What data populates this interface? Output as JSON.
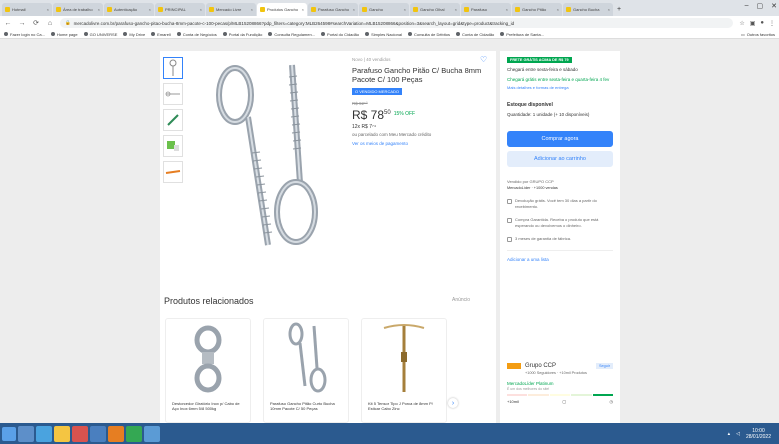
{
  "browser": {
    "tabs": [
      {
        "title": "Hotmail"
      },
      {
        "title": "Área de trabalho"
      },
      {
        "title": "Autenticação"
      },
      {
        "title": "PRINCIPAL"
      },
      {
        "title": "Mercado Livre"
      },
      {
        "title": "Produtos Gancho"
      },
      {
        "title": "Parafuso Gancho"
      },
      {
        "title": "Gancho"
      },
      {
        "title": "Gancho Olhal"
      },
      {
        "title": "Parafuso"
      },
      {
        "title": "Gancho Pitão"
      },
      {
        "title": "Gancho Bucha"
      }
    ],
    "url": "mercadolivre.com.br/parafuso-gancho-pitao-bucha-8mm-pacote-c-100-pecas/p/MLB15208866?pdp_filters=category:MLB264598#searchVariation=MLB15208866&position=3&search_layout=grid&type=product&tracking_id",
    "bookmarks": [
      "Fazer login no Ca...",
      "Home page",
      "GO UNIVERSE",
      "My Drive",
      "Emarell",
      "Conta de Negócios",
      "Portal da Fundição",
      "Consulta Regulamen...",
      "Portal do Cidadão",
      "Simples Nacional",
      "Consulta de Débitos",
      "Conta de Cidadão",
      "Prefeitura de Santa..."
    ],
    "other_bookmarks": "Outros favoritos"
  },
  "product": {
    "condition": "Novo | 40 vendidos",
    "title": "Parafuso Gancho Pitão C/ Bucha 8mm Pacote C/ 100 Peças",
    "badge": "O VENDIDO MERCADO",
    "old_price": "R$ 92⁶⁰",
    "price_main": "R$ 78",
    "price_cents": "50",
    "discount": "15% OFF",
    "installments": "12x R$ 7⁷⁴",
    "payment_line": "ou parcelado com Meu Mercado crédito",
    "payment_link": "Ver os meios de pagamento",
    "thumbnails": [
      "hook-eye",
      "screw-hook",
      "bolt",
      "pack",
      "hook-orange"
    ]
  },
  "buybox": {
    "banner": "FRETE GRÁTIS ACIMA DE R$ 79",
    "delivery_text": "Chegará entre sexta-feira e sábado",
    "free_shipping": "Chegará grátis entre sexta-feira e quarta-feira 4 fev",
    "shipping_link": "Mais detalhes e formas de entrega",
    "stock": "Estoque disponível",
    "quantity": "Quantidade: 1 unidade (+ 10 disponíveis)",
    "buy_label": "Comprar agora",
    "cart_label": "Adicionar ao carrinho",
    "seller_label": "Vendido por GRUPO CCP",
    "seller_sales": "MercadoLíder · +1000 vendas",
    "features": [
      {
        "icon": "return-icon",
        "text": "Devolução grátis. Você tem 30 dias a partir do recebimento."
      },
      {
        "icon": "shield-icon",
        "text": "Compra Garantida. Receba o produto que está esperando ou devolvemos o dinheiro."
      },
      {
        "icon": "warranty-icon",
        "text": "3 meses de garantia de fábrica."
      }
    ],
    "add_list": "Adicionar a uma lista"
  },
  "related": {
    "title": "Produtos relacionados",
    "more": "Anúncio",
    "items": [
      {
        "title": "Destorcedor Giratório Inox p/ Cabo de Aço Inox 6mm 5/8 500kg"
      },
      {
        "title": "Parafuso Gancho Pitão Curto Bucha 10mm Pacote C/ 50 Peças"
      },
      {
        "title": "Kit 5 Tensor Tipo J Porca de 8mm P/ Esticar Cabo Zinc"
      }
    ]
  },
  "seller_card": {
    "name": "Grupo CCP",
    "follow": "Seguir",
    "stats": "+1000 Seguidores · +10mil Produtos",
    "mlp": "MercadoLíder Platinum",
    "mlp_sub": "É um dos melhores do site!",
    "metrics": [
      "+10mil",
      "▢",
      "◷"
    ]
  },
  "taskbar": {
    "time": "10:00",
    "date": "28/01/2022"
  }
}
